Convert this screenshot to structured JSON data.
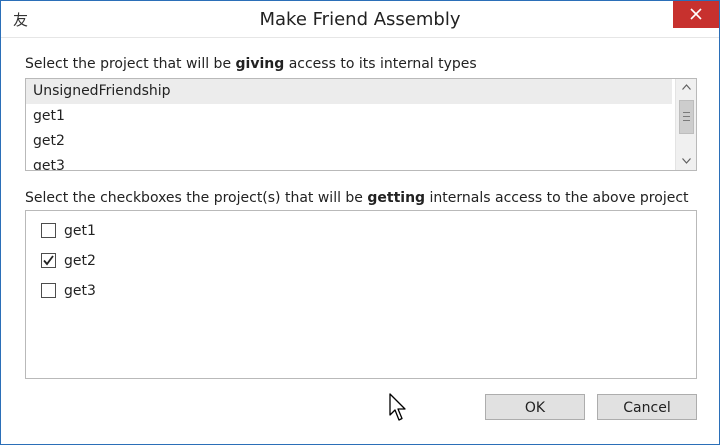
{
  "window": {
    "title": "Make Friend Assembly",
    "app_icon": "友"
  },
  "giving": {
    "label_prefix": "Select the project that will be ",
    "label_bold": "giving",
    "label_suffix": " access to its internal types",
    "items": [
      "UnsignedFriendship",
      "get1",
      "get2",
      "get3"
    ],
    "selected_index": 0
  },
  "getting": {
    "label_prefix": "Select the checkboxes the project(s) that will be ",
    "label_bold": "getting",
    "label_suffix": " internals access to the above project",
    "items": [
      {
        "label": "get1",
        "checked": false
      },
      {
        "label": "get2",
        "checked": true
      },
      {
        "label": "get3",
        "checked": false
      }
    ]
  },
  "buttons": {
    "ok": "OK",
    "cancel": "Cancel"
  },
  "icons": {
    "close": "close-icon",
    "scroll_up": "chevron-up-icon",
    "scroll_down": "chevron-down-icon",
    "check": "checkmark-icon",
    "cursor": "mouse-pointer-icon"
  },
  "colors": {
    "close_bg": "#c7312e",
    "window_border": "#2b6fb8",
    "selection_bg": "#ececec",
    "button_bg": "#e1e1e1"
  }
}
